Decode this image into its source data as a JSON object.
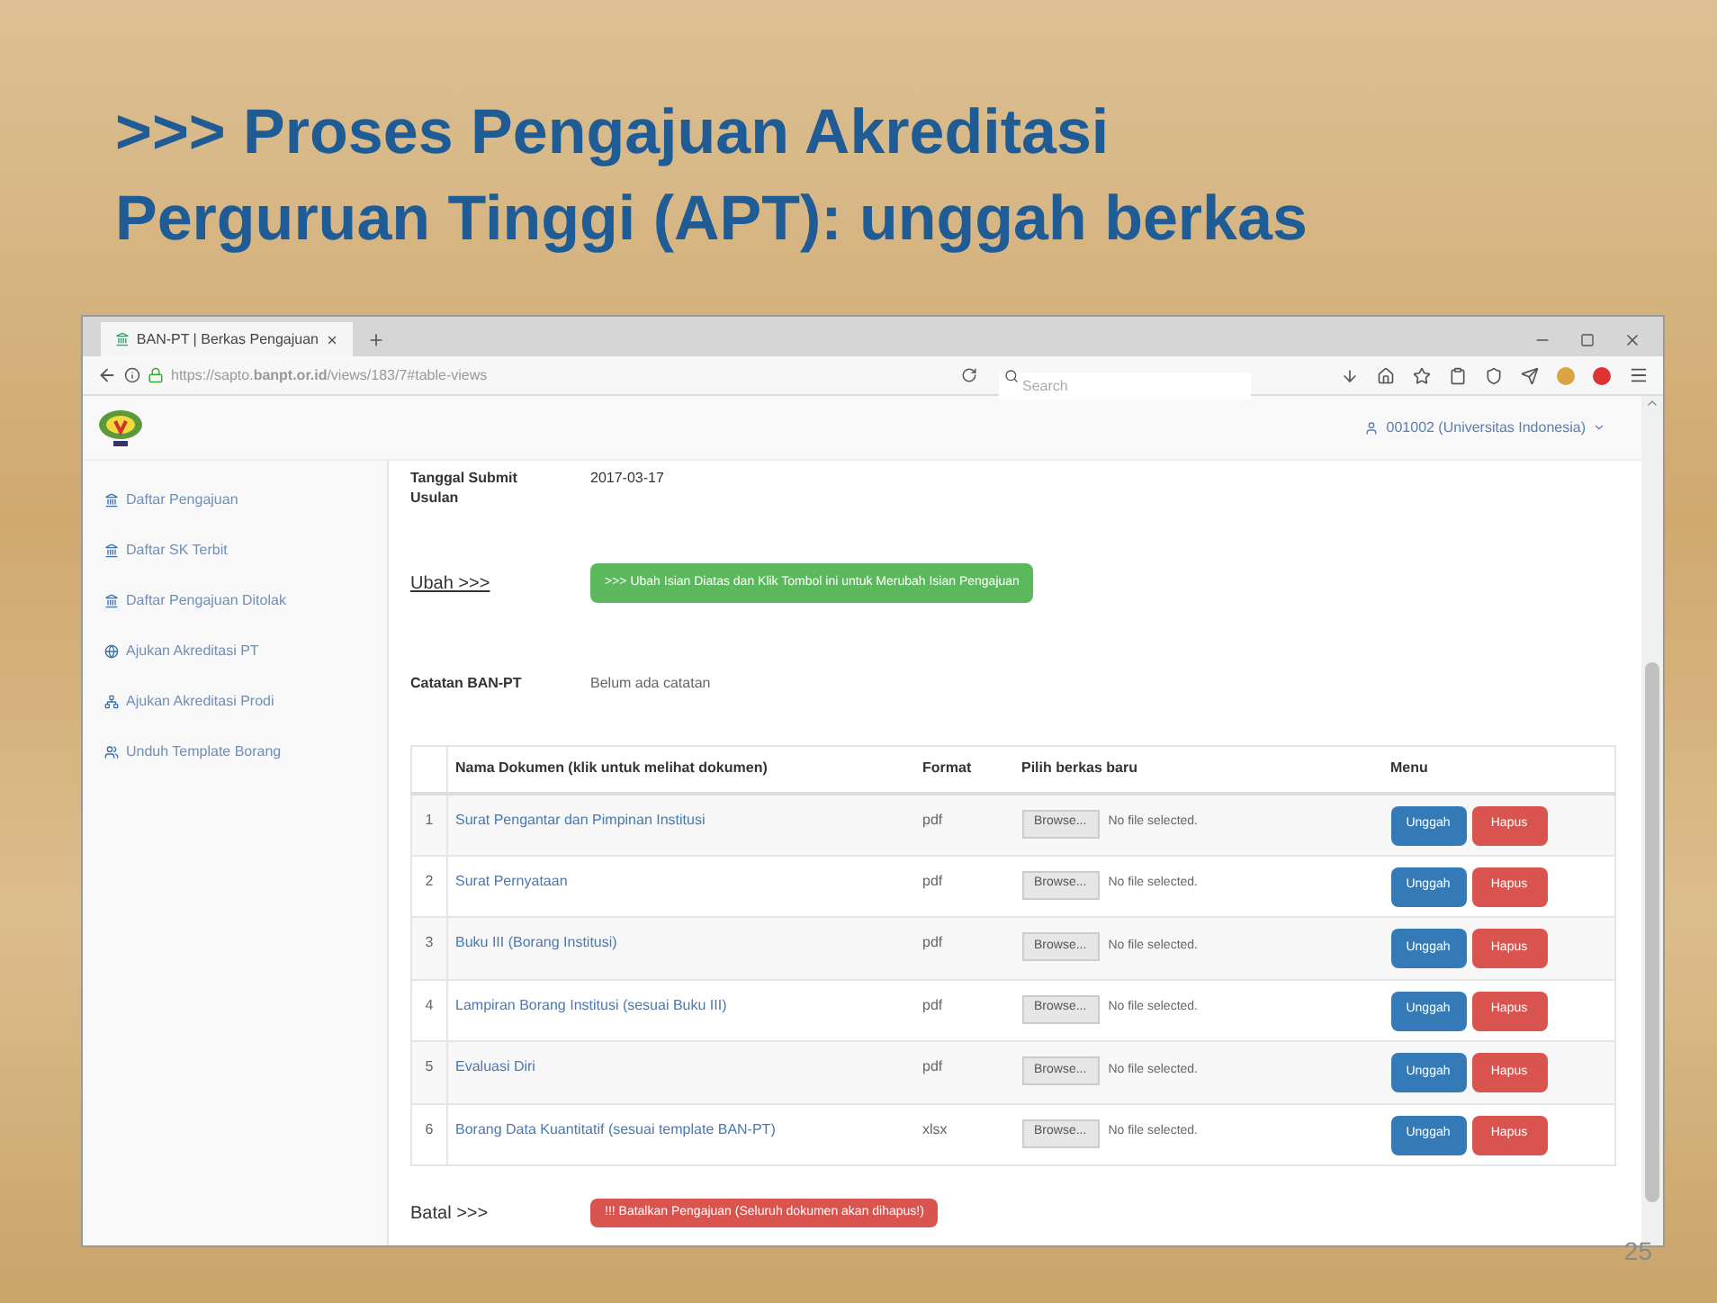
{
  "slide": {
    "title_lines": [
      ">>> Proses Pengajuan Akreditasi",
      "Perguruan Tinggi (APT): unggah berkas"
    ],
    "page_number": "25"
  },
  "browser": {
    "tab_title": "BAN-PT | Berkas Pengajuan",
    "url": "https://sapto.**banpt.or.id**/views/183/7#table-views",
    "search_placeholder": "Search",
    "user_menu": "001002 (Universitas Indonesia)"
  },
  "sidebar": {
    "items": [
      {
        "label": "Daftar Pengajuan",
        "kind": "bank"
      },
      {
        "label": "Daftar SK Terbit",
        "kind": "bank"
      },
      {
        "label": "Daftar Pengajuan Ditolak",
        "kind": "bank"
      },
      {
        "label": "Ajukan Akreditasi PT",
        "kind": "globe"
      },
      {
        "label": "Ajukan Akreditasi Prodi",
        "kind": "network"
      },
      {
        "label": "Unduh Template Borang",
        "kind": "users"
      }
    ]
  },
  "details": {
    "submit_label": "Tanggal Submit Usulan",
    "submit_value": "2017-03-17",
    "edit_link": "Ubah >>>",
    "edit_button": ">>> Ubah Isian Diatas dan Klik Tombol ini untuk Merubah Isian Pengajuan",
    "notes_label": "Catatan BAN-PT",
    "notes_value": "Belum ada catatan"
  },
  "table": {
    "columns": [
      "Nama Dokumen (klik untuk melihat dokumen)",
      "Format",
      "Pilih berkas baru",
      "Menu"
    ],
    "rows": [
      {
        "no": "1",
        "name": "Surat Pengantar dan Pimpinan Institusi",
        "format": "pdf",
        "browse": "Browse...",
        "file_status": "No file selected.",
        "upload": "Unggah",
        "delete": "Hapus"
      },
      {
        "no": "2",
        "name": "Surat Pernyataan",
        "format": "pdf",
        "browse": "Browse...",
        "file_status": "No file selected.",
        "upload": "Unggah",
        "delete": "Hapus"
      },
      {
        "no": "3",
        "name": "Buku III (Borang Institusi)",
        "format": "pdf",
        "browse": "Browse...",
        "file_status": "No file selected.",
        "upload": "Unggah",
        "delete": "Hapus"
      },
      {
        "no": "4",
        "name": "Lampiran Borang Institusi (sesuai Buku III)",
        "format": "pdf",
        "browse": "Browse...",
        "file_status": "No file selected.",
        "upload": "Unggah",
        "delete": "Hapus"
      },
      {
        "no": "5",
        "name": "Evaluasi Diri",
        "format": "pdf",
        "browse": "Browse...",
        "file_status": "No file selected.",
        "upload": "Unggah",
        "delete": "Hapus"
      },
      {
        "no": "6",
        "name": "Borang Data Kuantitatif (sesuai template BAN-PT)",
        "format": "xlsx",
        "browse": "Browse...",
        "file_status": "No file selected.",
        "upload": "Unggah",
        "delete": "Hapus"
      }
    ]
  },
  "cancel": {
    "link": "Batal >>>",
    "button": "!!! Batalkan Pengajuan (Seluruh dokumen akan dihapus!)"
  }
}
